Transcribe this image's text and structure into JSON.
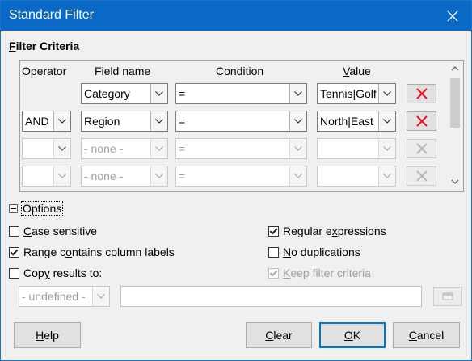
{
  "window": {
    "title": "Standard Filter"
  },
  "filter_criteria": {
    "section_title_mnemonic": "F",
    "section_title_rest": "ilter Criteria",
    "headers": {
      "operator": "Operator",
      "field_name": "Field name",
      "condition": "Condition",
      "value": "Value"
    },
    "rows": [
      {
        "operator": "",
        "field": "Category",
        "condition": "=",
        "value": "Tennis|Golf",
        "enabled": true
      },
      {
        "operator": "AND",
        "field": "Region",
        "condition": "=",
        "value": "North|East",
        "enabled": true
      },
      {
        "operator": "",
        "field": "- none -",
        "condition": "=",
        "value": "",
        "enabled": false
      },
      {
        "operator": "",
        "field": "- none -",
        "condition": "=",
        "value": "",
        "enabled": false
      }
    ]
  },
  "options": {
    "toggle_label": "Options",
    "case_sensitive": {
      "label_mnemonic": "C",
      "label_rest": "ase sensitive",
      "checked": false
    },
    "range_contains_labels": {
      "label_pre": "Range c",
      "label_mnemonic": "o",
      "label_rest": "ntains column labels",
      "checked": true
    },
    "copy_results": {
      "label_pre": "Cop",
      "label_mnemonic": "y",
      "label_rest": " results to:",
      "checked": false
    },
    "regular_expressions": {
      "label_pre": "Regular e",
      "label_mnemonic": "x",
      "label_rest": "pressions",
      "checked": true
    },
    "no_duplications": {
      "label_mnemonic": "N",
      "label_rest": "o duplications",
      "checked": false
    },
    "keep_filter_criteria": {
      "label_mnemonic": "K",
      "label_rest": "eep filter criteria",
      "checked": true
    },
    "copy_target_select": "- undefined -",
    "copy_target_field": ""
  },
  "buttons": {
    "help": {
      "mnemonic": "H",
      "rest": "elp"
    },
    "clear": {
      "mnemonic": "C",
      "rest": "lear"
    },
    "ok": {
      "mnemonic": "O",
      "rest": "K"
    },
    "cancel": {
      "mnemonic": "C",
      "rest": "ancel"
    }
  },
  "colors": {
    "titlebar": "#0a68c7",
    "delete_x": "#e81123",
    "default_button_border": "#0078d7"
  }
}
